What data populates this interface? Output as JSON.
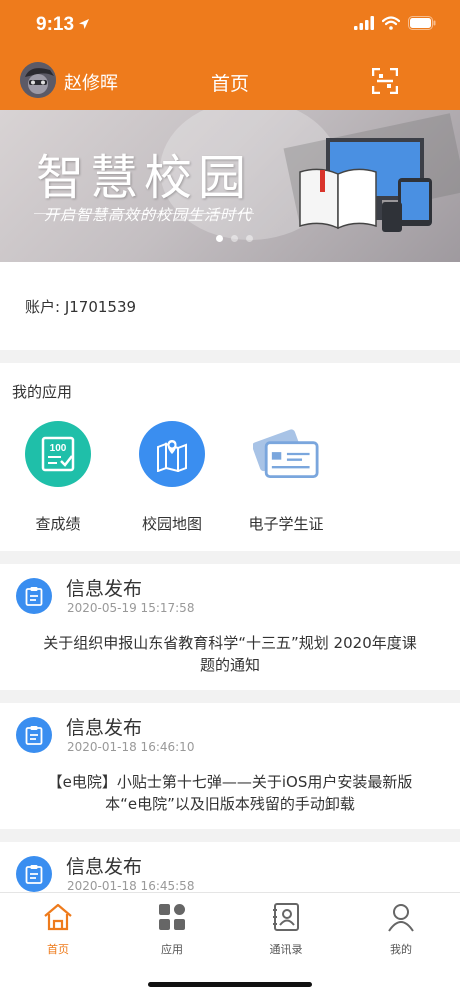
{
  "status": {
    "time": "9:13"
  },
  "nav": {
    "user_name": "赵修晖",
    "title": "首页"
  },
  "banner": {
    "title": "智慧校园",
    "subtitle": "开启智慧高效的校园生活时代",
    "page_count": 3,
    "active_page": 1
  },
  "account": {
    "label": "账户: J1701539"
  },
  "apps": {
    "title": "我的应用",
    "items": [
      {
        "label": "查成绩",
        "icon": "grade-report-icon",
        "color": "#1fbfa9"
      },
      {
        "label": "校园地图",
        "icon": "campus-map-icon",
        "color": "#3a8ef0"
      },
      {
        "label": "电子学生证",
        "icon": "student-card-icon",
        "color": "#7aa6dd"
      }
    ]
  },
  "news": [
    {
      "title": "信息发布",
      "time": "2020-05-19 15:17:58",
      "body": "关于组织申报山东省教育科学“十三五”规划 2020年度课题的通知"
    },
    {
      "title": "信息发布",
      "time": "2020-01-18 16:46:10",
      "body": "【e电院】小贴士第十七弹——关于iOS用户安装最新版本“e电院”以及旧版本残留的手动卸载"
    },
    {
      "title": "信息发布",
      "time": "2020-01-18 16:45:58",
      "body": ""
    }
  ],
  "tabs": [
    {
      "label": "首页",
      "icon": "home-icon",
      "active": true
    },
    {
      "label": "应用",
      "icon": "apps-grid-icon",
      "active": false
    },
    {
      "label": "通讯录",
      "icon": "contacts-icon",
      "active": false
    },
    {
      "label": "我的",
      "icon": "profile-icon",
      "active": false
    }
  ],
  "colors": {
    "brand": "#ee7b1c",
    "news_icon": "#3a8ef0",
    "background": "#f2f2f2"
  }
}
